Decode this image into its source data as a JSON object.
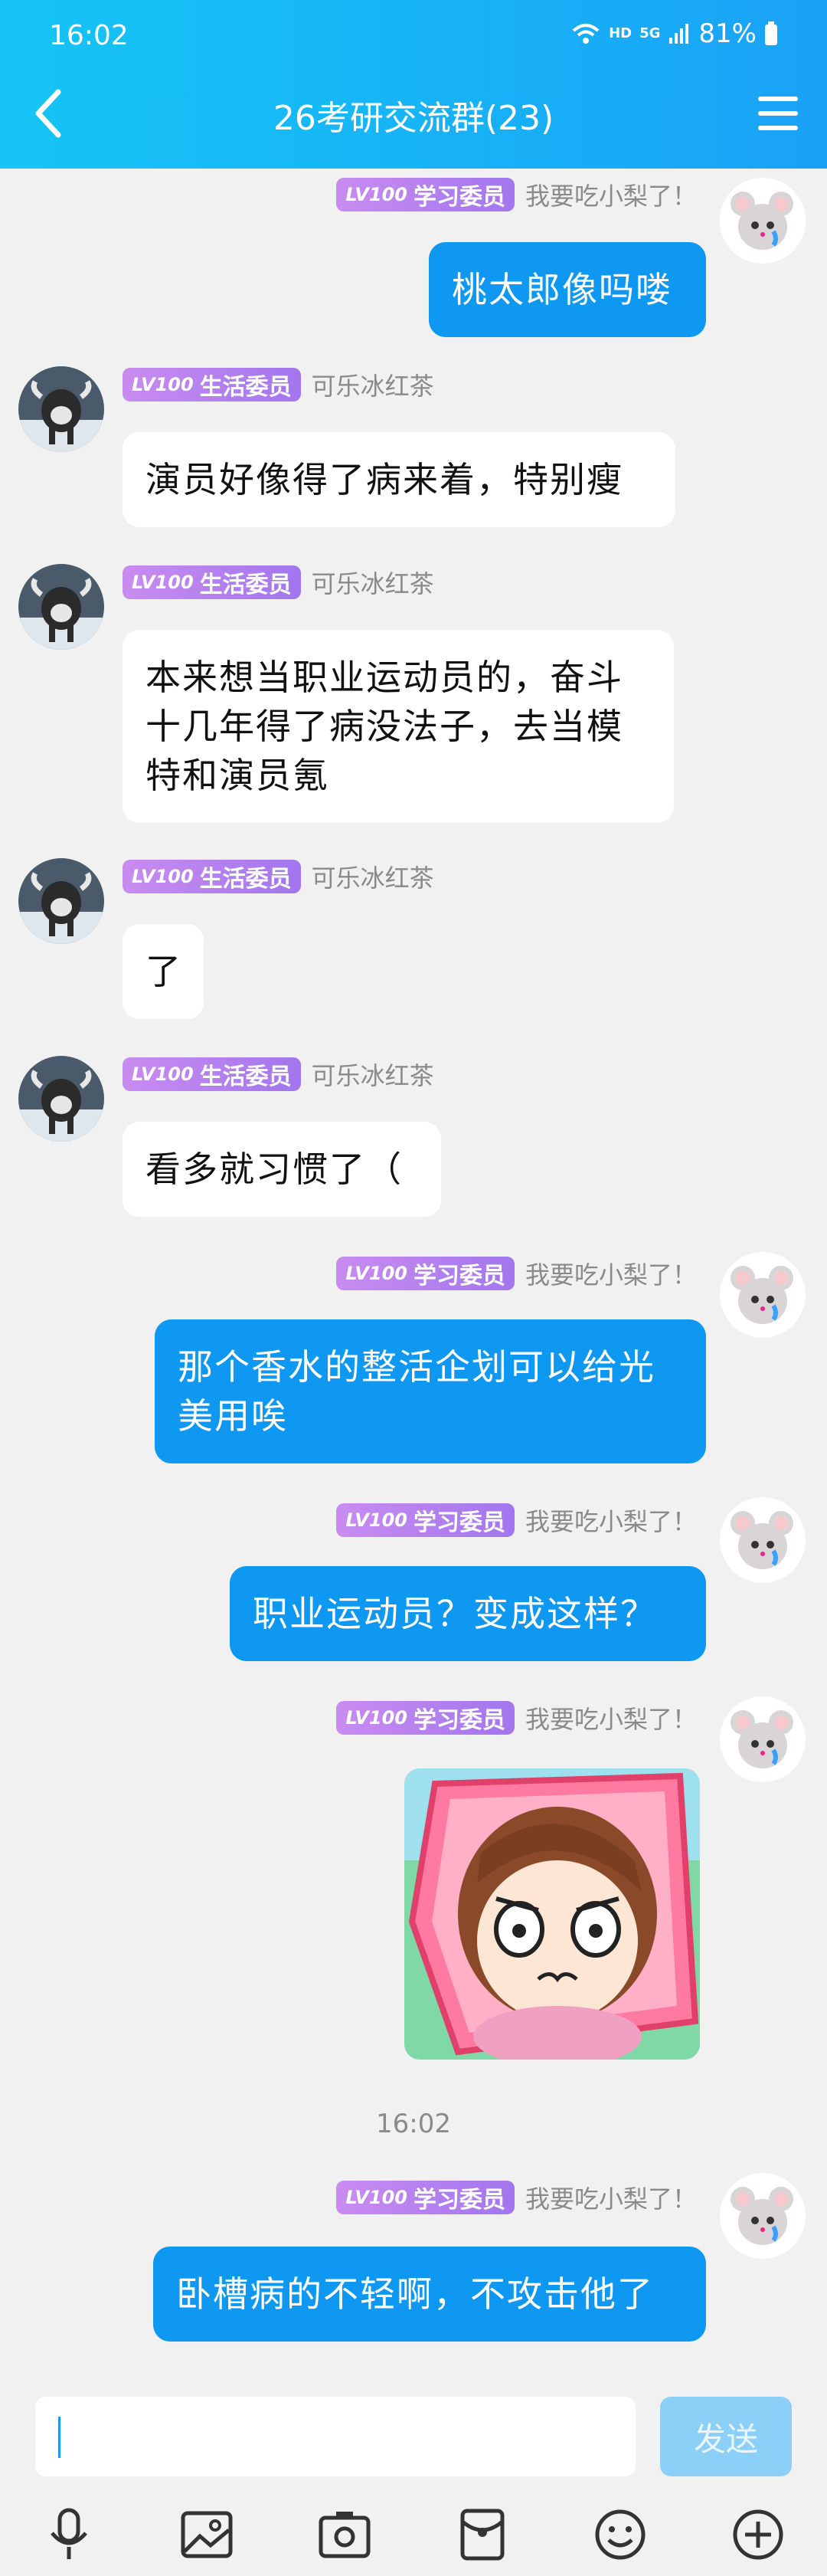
{
  "status_bar": {
    "time": "16:02",
    "network_hd": "HD",
    "network_5g": "5G",
    "battery": "81%"
  },
  "header": {
    "title": "26考研交流群(23)"
  },
  "messages": [
    {
      "side": "out",
      "badge_level": "LV100",
      "badge_title": "学习委员",
      "nickname": "我要吃小梨了！",
      "text": "桃太郎像吗喽"
    },
    {
      "side": "in",
      "badge_level": "LV100",
      "badge_title": "生活委员",
      "nickname": "可乐冰红茶",
      "text": "演员好像得了病来着，特别瘦"
    },
    {
      "side": "in",
      "badge_level": "LV100",
      "badge_title": "生活委员",
      "nickname": "可乐冰红茶",
      "text_lines": [
        "本来想当职业运动员的，奋斗",
        "十几年得了病没法子，去当模",
        "特和演员氪"
      ]
    },
    {
      "side": "in",
      "badge_level": "LV100",
      "badge_title": "生活委员",
      "nickname": "可乐冰红茶",
      "text": "了"
    },
    {
      "side": "in",
      "badge_level": "LV100",
      "badge_title": "生活委员",
      "nickname": "可乐冰红茶",
      "text": "看多就习惯了（"
    },
    {
      "side": "out",
      "badge_level": "LV100",
      "badge_title": "学习委员",
      "nickname": "我要吃小梨了！",
      "text_lines": [
        "那个香水的整活企划可以给光",
        "美用唉"
      ]
    },
    {
      "side": "out",
      "badge_level": "LV100",
      "badge_title": "学习委员",
      "nickname": "我要吃小梨了！",
      "text": "职业运动员？变成这样？"
    },
    {
      "side": "out",
      "badge_level": "LV100",
      "badge_title": "学习委员",
      "nickname": "我要吃小梨了！",
      "sticker": "angry-anime-girl-sticker"
    },
    {
      "timestamp": "16:02"
    },
    {
      "side": "out",
      "badge_level": "LV100",
      "badge_title": "学习委员",
      "nickname": "我要吃小梨了！",
      "text": "卧槽病的不轻啊，不攻击他了"
    }
  ],
  "input": {
    "placeholder": "",
    "send_label": "发送"
  },
  "toolbar": [
    "microphone-icon",
    "image-icon",
    "camera-icon",
    "red-packet-icon",
    "emoji-icon",
    "plus-icon"
  ],
  "colors": {
    "header_start": "#16c5f5",
    "header_end": "#1aa2f6",
    "bubble_out": "#0e98f2",
    "bubble_in": "#ffffff",
    "badge": "#b27ff0",
    "send_disabled": "#8ccff7"
  }
}
